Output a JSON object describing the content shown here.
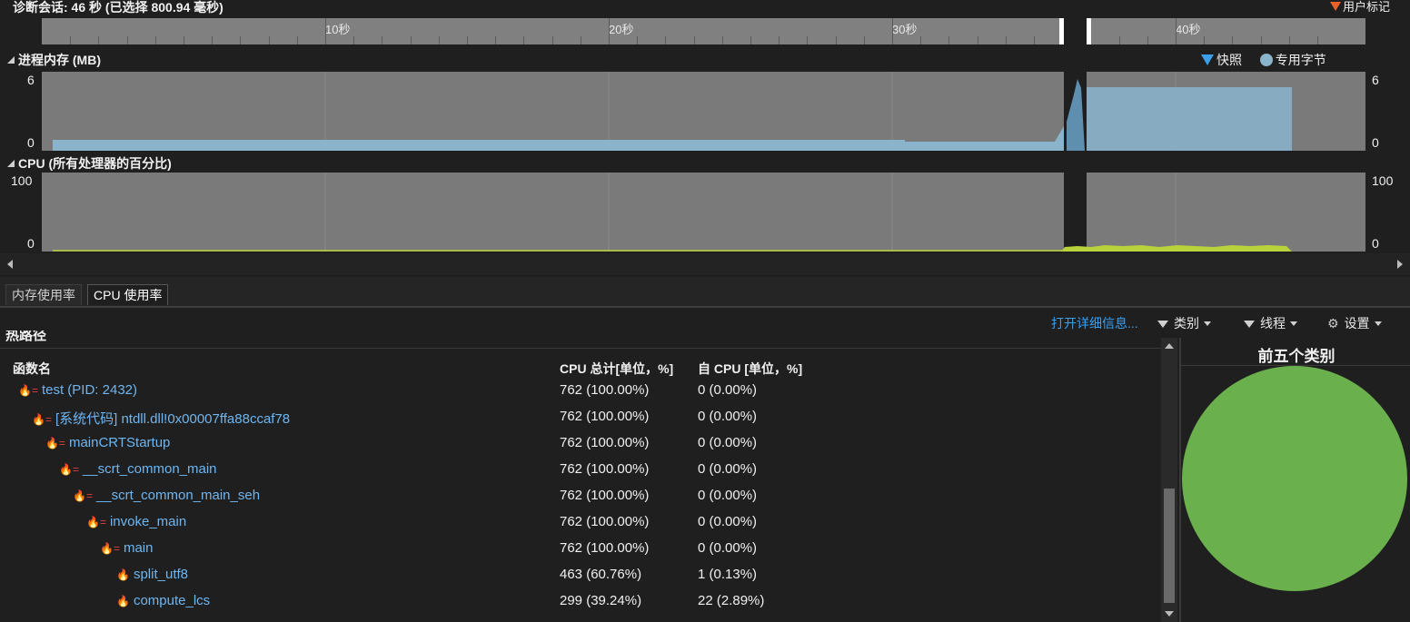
{
  "session": {
    "title": "诊断会话: 46 秒 (已选择 800.94 毫秒)",
    "user_mark_label": "用户标记"
  },
  "ruler": {
    "labels": [
      "10秒",
      "20秒",
      "30秒",
      "40秒"
    ]
  },
  "memory": {
    "title": "进程内存 (MB)",
    "y_max": "6",
    "y_min": "0",
    "legend_snapshot": "快照",
    "legend_private": "专用字节"
  },
  "cpu": {
    "title": "CPU (所有处理器的百分比)",
    "y_max": "100",
    "y_min": "0"
  },
  "tabs": [
    "内存使用率",
    "CPU 使用率"
  ],
  "toolbar": {
    "open_details": "打开详细信息...",
    "category": "类别",
    "thread": "线程",
    "settings": "设置"
  },
  "table": {
    "section_label": "热路径",
    "col_name": "函数名",
    "col_total": "CPU 总计[单位，%]",
    "col_self": "自 CPU [单位，%]",
    "rows": [
      {
        "name": "test (PID: 2432)",
        "total": "762 (100.00%)",
        "self": "0 (0.00%)"
      },
      {
        "name": "[系统代码] ntdll.dll!0x00007ffa88ccaf78",
        "total": "762 (100.00%)",
        "self": "0 (0.00%)"
      },
      {
        "name": "mainCRTStartup",
        "total": "762 (100.00%)",
        "self": "0 (0.00%)"
      },
      {
        "name": "__scrt_common_main",
        "total": "762 (100.00%)",
        "self": "0 (0.00%)"
      },
      {
        "name": "__scrt_common_main_seh",
        "total": "762 (100.00%)",
        "self": "0 (0.00%)"
      },
      {
        "name": "invoke_main",
        "total": "762 (100.00%)",
        "self": "0 (0.00%)"
      },
      {
        "name": "main",
        "total": "762 (100.00%)",
        "self": "0 (0.00%)"
      },
      {
        "name": "split_utf8",
        "total": "463 (60.76%)",
        "self": "1 (0.13%)"
      },
      {
        "name": "compute_lcs",
        "total": "299 (39.24%)",
        "self": "22 (2.89%)"
      }
    ]
  },
  "top5": {
    "title": "前五个类别"
  },
  "colors": {
    "accent_link": "#3aa0f0",
    "memory_fill": "#8ab4cc",
    "cpu_line": "#b8d23c",
    "pie_green": "#6ab04c",
    "user_mark": "#e8622a"
  }
}
